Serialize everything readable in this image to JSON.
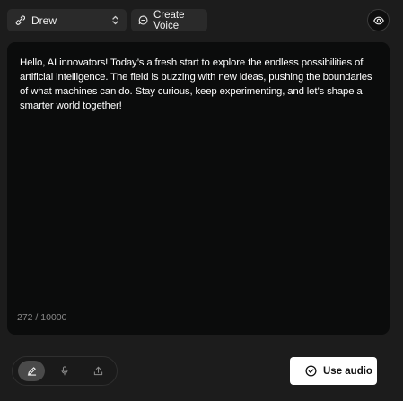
{
  "voice_selector": {
    "selected": "Drew",
    "icon": "voice-link-icon",
    "chevron_icon": "chevron-updown-icon"
  },
  "create_voice": {
    "label": "Create Voice",
    "icon": "chat-bubble-icon"
  },
  "preview_toggle": {
    "icon": "eye-icon"
  },
  "editor": {
    "text": "Hello, AI  innovators! Today’s a fresh start to explore the endless possibilities of artificial intelligence. The field is buzzing with new ideas, pushing the boundaries of what machines can do. Stay curious, keep experimenting, and let’s shape a smarter world together!",
    "char_count": "272 / 10000"
  },
  "input_modes": [
    {
      "icon": "pencil-icon",
      "active": true
    },
    {
      "icon": "microphone-icon",
      "active": false
    },
    {
      "icon": "upload-icon",
      "active": false
    }
  ],
  "use_audio": {
    "label": "Use audio",
    "icon": "check-circle-icon"
  },
  "colors": {
    "background": "#1c1c1c",
    "panel": "#0b0c0c",
    "button": "#2a2a2a",
    "primary": "#ffffff"
  }
}
